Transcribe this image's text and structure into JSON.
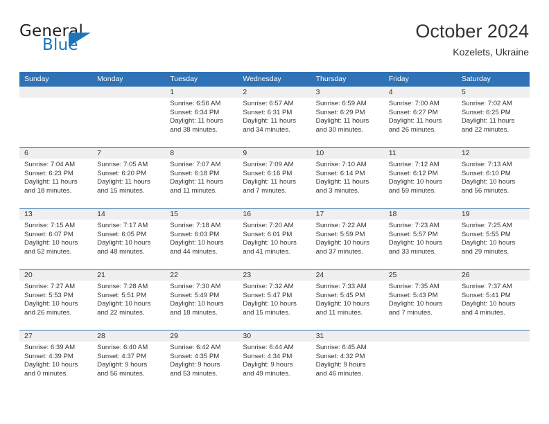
{
  "brand": {
    "word1": "General",
    "word2": "Blue",
    "logo_icon": "blue-triangle-logo"
  },
  "header": {
    "title": "October 2024",
    "subtitle": "Kozelets, Ukraine"
  },
  "colors": {
    "header_blue": "#2f72b5",
    "brand_blue": "#1b75bb",
    "banner_gray": "#efefef",
    "text": "#333333"
  },
  "weekday_headers": [
    "Sunday",
    "Monday",
    "Tuesday",
    "Wednesday",
    "Thursday",
    "Friday",
    "Saturday"
  ],
  "weeks": [
    [
      {
        "date": "",
        "sunrise": "",
        "sunset": "",
        "daylight_line1": "",
        "daylight_line2": "",
        "empty": true
      },
      {
        "date": "",
        "sunrise": "",
        "sunset": "",
        "daylight_line1": "",
        "daylight_line2": "",
        "empty": true
      },
      {
        "date": "1",
        "sunrise": "Sunrise: 6:56 AM",
        "sunset": "Sunset: 6:34 PM",
        "daylight_line1": "Daylight: 11 hours",
        "daylight_line2": "and 38 minutes."
      },
      {
        "date": "2",
        "sunrise": "Sunrise: 6:57 AM",
        "sunset": "Sunset: 6:31 PM",
        "daylight_line1": "Daylight: 11 hours",
        "daylight_line2": "and 34 minutes."
      },
      {
        "date": "3",
        "sunrise": "Sunrise: 6:59 AM",
        "sunset": "Sunset: 6:29 PM",
        "daylight_line1": "Daylight: 11 hours",
        "daylight_line2": "and 30 minutes."
      },
      {
        "date": "4",
        "sunrise": "Sunrise: 7:00 AM",
        "sunset": "Sunset: 6:27 PM",
        "daylight_line1": "Daylight: 11 hours",
        "daylight_line2": "and 26 minutes."
      },
      {
        "date": "5",
        "sunrise": "Sunrise: 7:02 AM",
        "sunset": "Sunset: 6:25 PM",
        "daylight_line1": "Daylight: 11 hours",
        "daylight_line2": "and 22 minutes."
      }
    ],
    [
      {
        "date": "6",
        "sunrise": "Sunrise: 7:04 AM",
        "sunset": "Sunset: 6:23 PM",
        "daylight_line1": "Daylight: 11 hours",
        "daylight_line2": "and 18 minutes."
      },
      {
        "date": "7",
        "sunrise": "Sunrise: 7:05 AM",
        "sunset": "Sunset: 6:20 PM",
        "daylight_line1": "Daylight: 11 hours",
        "daylight_line2": "and 15 minutes."
      },
      {
        "date": "8",
        "sunrise": "Sunrise: 7:07 AM",
        "sunset": "Sunset: 6:18 PM",
        "daylight_line1": "Daylight: 11 hours",
        "daylight_line2": "and 11 minutes."
      },
      {
        "date": "9",
        "sunrise": "Sunrise: 7:09 AM",
        "sunset": "Sunset: 6:16 PM",
        "daylight_line1": "Daylight: 11 hours",
        "daylight_line2": "and 7 minutes."
      },
      {
        "date": "10",
        "sunrise": "Sunrise: 7:10 AM",
        "sunset": "Sunset: 6:14 PM",
        "daylight_line1": "Daylight: 11 hours",
        "daylight_line2": "and 3 minutes."
      },
      {
        "date": "11",
        "sunrise": "Sunrise: 7:12 AM",
        "sunset": "Sunset: 6:12 PM",
        "daylight_line1": "Daylight: 10 hours",
        "daylight_line2": "and 59 minutes."
      },
      {
        "date": "12",
        "sunrise": "Sunrise: 7:13 AM",
        "sunset": "Sunset: 6:10 PM",
        "daylight_line1": "Daylight: 10 hours",
        "daylight_line2": "and 56 minutes."
      }
    ],
    [
      {
        "date": "13",
        "sunrise": "Sunrise: 7:15 AM",
        "sunset": "Sunset: 6:07 PM",
        "daylight_line1": "Daylight: 10 hours",
        "daylight_line2": "and 52 minutes."
      },
      {
        "date": "14",
        "sunrise": "Sunrise: 7:17 AM",
        "sunset": "Sunset: 6:05 PM",
        "daylight_line1": "Daylight: 10 hours",
        "daylight_line2": "and 48 minutes."
      },
      {
        "date": "15",
        "sunrise": "Sunrise: 7:18 AM",
        "sunset": "Sunset: 6:03 PM",
        "daylight_line1": "Daylight: 10 hours",
        "daylight_line2": "and 44 minutes."
      },
      {
        "date": "16",
        "sunrise": "Sunrise: 7:20 AM",
        "sunset": "Sunset: 6:01 PM",
        "daylight_line1": "Daylight: 10 hours",
        "daylight_line2": "and 41 minutes."
      },
      {
        "date": "17",
        "sunrise": "Sunrise: 7:22 AM",
        "sunset": "Sunset: 5:59 PM",
        "daylight_line1": "Daylight: 10 hours",
        "daylight_line2": "and 37 minutes."
      },
      {
        "date": "18",
        "sunrise": "Sunrise: 7:23 AM",
        "sunset": "Sunset: 5:57 PM",
        "daylight_line1": "Daylight: 10 hours",
        "daylight_line2": "and 33 minutes."
      },
      {
        "date": "19",
        "sunrise": "Sunrise: 7:25 AM",
        "sunset": "Sunset: 5:55 PM",
        "daylight_line1": "Daylight: 10 hours",
        "daylight_line2": "and 29 minutes."
      }
    ],
    [
      {
        "date": "20",
        "sunrise": "Sunrise: 7:27 AM",
        "sunset": "Sunset: 5:53 PM",
        "daylight_line1": "Daylight: 10 hours",
        "daylight_line2": "and 26 minutes."
      },
      {
        "date": "21",
        "sunrise": "Sunrise: 7:28 AM",
        "sunset": "Sunset: 5:51 PM",
        "daylight_line1": "Daylight: 10 hours",
        "daylight_line2": "and 22 minutes."
      },
      {
        "date": "22",
        "sunrise": "Sunrise: 7:30 AM",
        "sunset": "Sunset: 5:49 PM",
        "daylight_line1": "Daylight: 10 hours",
        "daylight_line2": "and 18 minutes."
      },
      {
        "date": "23",
        "sunrise": "Sunrise: 7:32 AM",
        "sunset": "Sunset: 5:47 PM",
        "daylight_line1": "Daylight: 10 hours",
        "daylight_line2": "and 15 minutes."
      },
      {
        "date": "24",
        "sunrise": "Sunrise: 7:33 AM",
        "sunset": "Sunset: 5:45 PM",
        "daylight_line1": "Daylight: 10 hours",
        "daylight_line2": "and 11 minutes."
      },
      {
        "date": "25",
        "sunrise": "Sunrise: 7:35 AM",
        "sunset": "Sunset: 5:43 PM",
        "daylight_line1": "Daylight: 10 hours",
        "daylight_line2": "and 7 minutes."
      },
      {
        "date": "26",
        "sunrise": "Sunrise: 7:37 AM",
        "sunset": "Sunset: 5:41 PM",
        "daylight_line1": "Daylight: 10 hours",
        "daylight_line2": "and 4 minutes."
      }
    ],
    [
      {
        "date": "27",
        "sunrise": "Sunrise: 6:39 AM",
        "sunset": "Sunset: 4:39 PM",
        "daylight_line1": "Daylight: 10 hours",
        "daylight_line2": "and 0 minutes."
      },
      {
        "date": "28",
        "sunrise": "Sunrise: 6:40 AM",
        "sunset": "Sunset: 4:37 PM",
        "daylight_line1": "Daylight: 9 hours",
        "daylight_line2": "and 56 minutes."
      },
      {
        "date": "29",
        "sunrise": "Sunrise: 6:42 AM",
        "sunset": "Sunset: 4:35 PM",
        "daylight_line1": "Daylight: 9 hours",
        "daylight_line2": "and 53 minutes."
      },
      {
        "date": "30",
        "sunrise": "Sunrise: 6:44 AM",
        "sunset": "Sunset: 4:34 PM",
        "daylight_line1": "Daylight: 9 hours",
        "daylight_line2": "and 49 minutes."
      },
      {
        "date": "31",
        "sunrise": "Sunrise: 6:45 AM",
        "sunset": "Sunset: 4:32 PM",
        "daylight_line1": "Daylight: 9 hours",
        "daylight_line2": "and 46 minutes."
      },
      {
        "date": "",
        "sunrise": "",
        "sunset": "",
        "daylight_line1": "",
        "daylight_line2": "",
        "empty": true
      },
      {
        "date": "",
        "sunrise": "",
        "sunset": "",
        "daylight_line1": "",
        "daylight_line2": "",
        "empty": true
      }
    ]
  ]
}
